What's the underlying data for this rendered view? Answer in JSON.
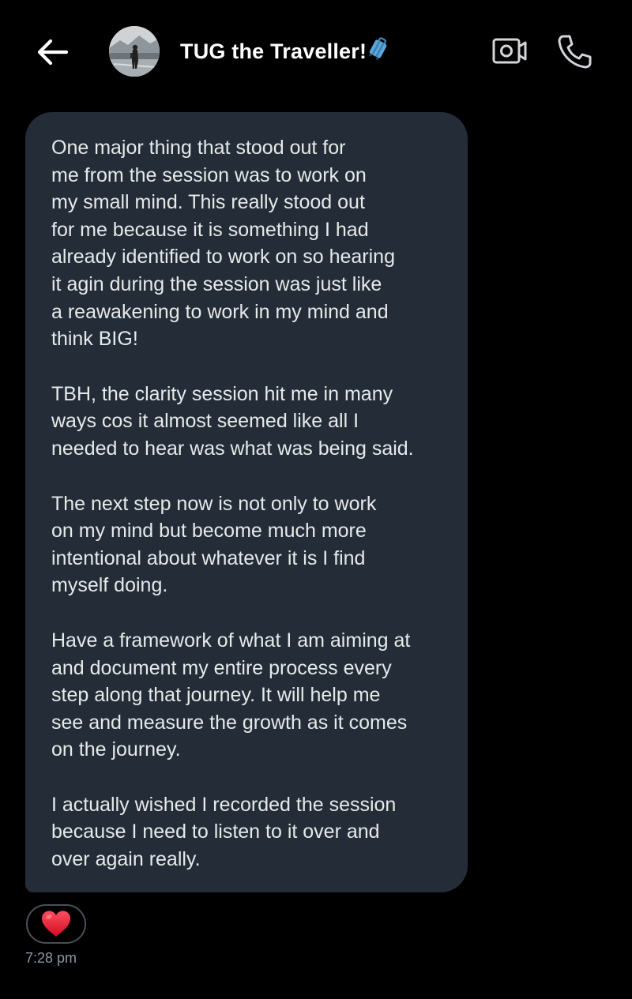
{
  "header": {
    "contact_name": "TUG the Traveller!",
    "name_emoji": "luggage-emoji",
    "back_icon": "arrow-left-icon",
    "video_call_icon": "video-camera-icon",
    "voice_call_icon": "phone-icon"
  },
  "message": {
    "paragraphs": [
      "One major thing that stood out for\nme from the session was to work on\nmy small mind. This really stood out\nfor me because it is something I had\nalready identified to work on so hearing\nit agin during the session was just like\na reawakening to work in my mind and\nthink BIG!",
      "TBH, the clarity session hit me in many\nways cos it almost seemed like all I\nneeded to hear was what was being said.",
      "The next step now is not only to work\non my mind but become much more\nintentional about whatever it is I find\nmyself doing.",
      "Have a framework of what I am aiming at\nand document my entire process every\nstep along that journey. It will help me\nsee and measure the growth as it comes\non the journey.",
      "I actually wished I recorded the session\nbecause I need to listen to it over and\nover again really."
    ],
    "reaction": "❤️",
    "time": "7:28 pm"
  },
  "colors": {
    "background": "#000000",
    "bubble": "#242d37",
    "text": "#e7e9ea",
    "muted": "#8b98a5",
    "heart": "#e0142a"
  }
}
